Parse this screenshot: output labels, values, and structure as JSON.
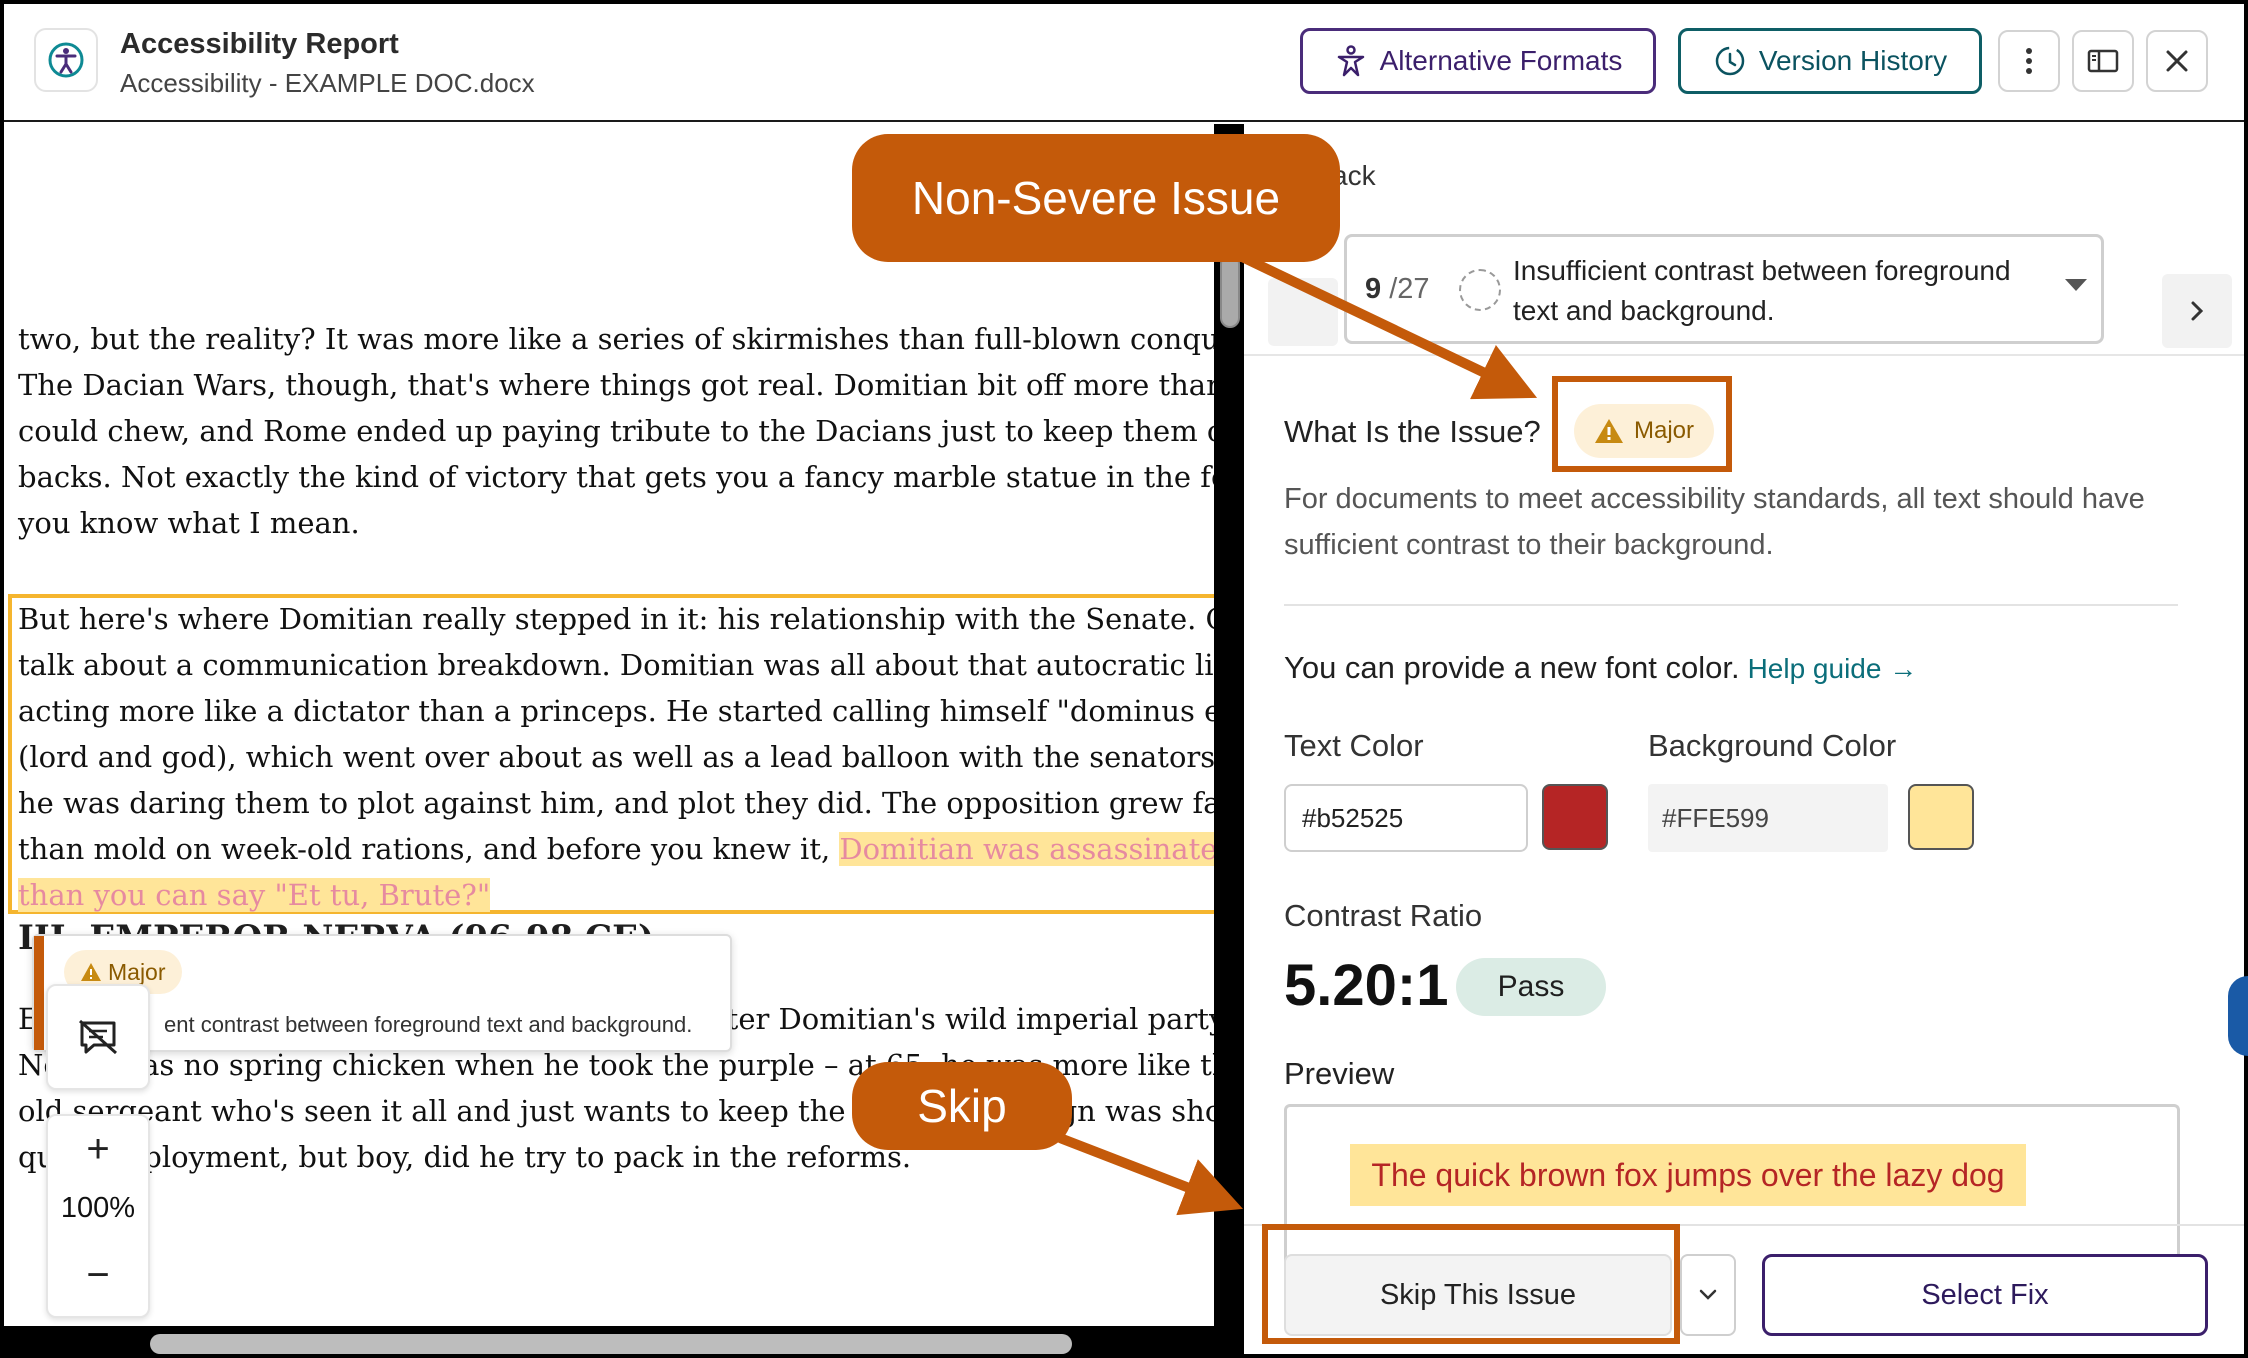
{
  "header": {
    "title": "Accessibility Report",
    "subtitle": "Accessibility - EXAMPLE DOC.docx",
    "alt_formats_label": "Alternative Formats",
    "version_history_label": "Version History"
  },
  "document": {
    "para1": [
      "two, but the reality? It was more like a series of skirmishes than full-blown conquests",
      "The Dacian Wars, though, that's where things got real. Domitian bit off more than he",
      "could chew, and Rome ended up paying tribute to the Dacians just to keep them off ou",
      "backs. Not exactly the kind of victory that gets you a fancy marble statue in the forum",
      "you know what I mean."
    ],
    "para2": [
      "But here's where Domitian really stepped in it: his relationship with the Senate. Oh bo",
      "talk about a communication breakdown. Domitian was all about that autocratic life,",
      "acting more like a dictator than a princeps. He started calling himself \"dominus et deu",
      "(lord and god), which went over about as well as a lead balloon with the senators. It's",
      "he was daring them to plot against him, and plot they did. The opposition grew faster"
    ],
    "para2_line6_start": "than mold on week-old rations, and before you knew it, ",
    "para2_line6_highlight": "Domitian was assassinated fa",
    "para2_line7_highlight": "than you can say \"Et tu, Brute?\"",
    "heading3": "III. EMPEROR NERVA (96-98 CE)",
    "para3": [
      "Enter Nerva, the guy tasked with cleaning up after Domitian's wild imperial party. Now,",
      "Nerva was no spring chicken when he took the purple – at 65, he was more like that w",
      "old sergeant who's seen it all and just wants to keep the peace. His reign was short, lik",
      "quick deployment, but boy, did he try to pack in the reforms."
    ]
  },
  "tooltip": {
    "badge": "Major",
    "text": "ent contrast between foreground text and background."
  },
  "zoom": {
    "in": "+",
    "level": "100%",
    "out": "−"
  },
  "panel": {
    "back": "ack",
    "issue_index": "9",
    "issue_total": "/27",
    "issue_title": "Insufficient contrast between foreground text and background.",
    "what_title": "What Is the Issue?",
    "severity": "Major",
    "what_desc": "For documents to meet accessibility standards, all text should have sufficient contrast to their background.",
    "provide_text": "You can provide a new font color.",
    "help_link": "Help guide →",
    "text_color_label": "Text Color",
    "text_color_value": "#b52525",
    "bg_color_label": "Background Color",
    "bg_color_value": "#FFE599",
    "contrast_label": "Contrast Ratio",
    "contrast_value": "5.20:1",
    "contrast_status": "Pass",
    "preview_label": "Preview",
    "preview_text": "The quick brown fox jumps over the lazy dog",
    "skip_label": "Skip This Issue",
    "select_fix_label": "Select Fix"
  },
  "annotations": {
    "non_severe": "Non-Severe Issue",
    "skip": "Skip"
  },
  "colors": {
    "accent_purple": "#3b1f6b",
    "accent_teal": "#0b5360",
    "callout_orange": "#c45a0a",
    "text_color": "#b52525",
    "bg_color": "#FFE599"
  }
}
